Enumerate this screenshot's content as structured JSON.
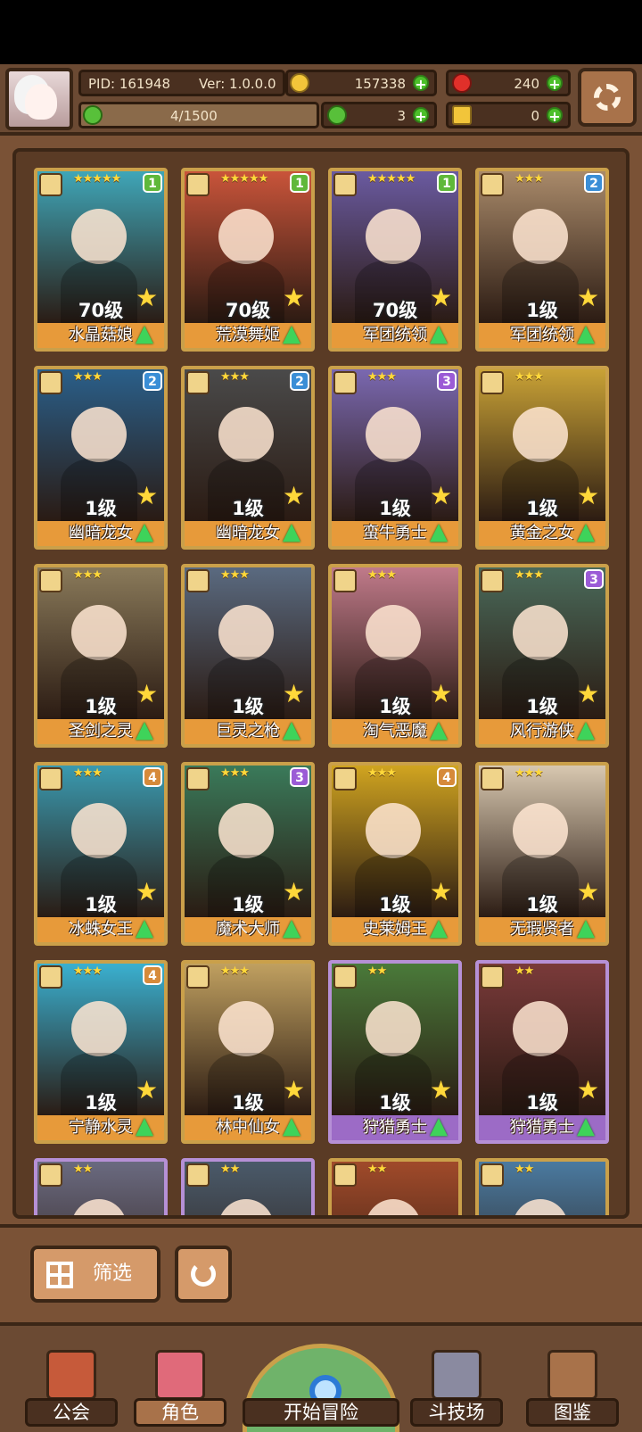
{
  "header": {
    "pid": "PID: 161948",
    "version": "Ver: 1.0.0.0",
    "gold": "157338",
    "gems": "240",
    "capacity": "4/1500",
    "clover": "3",
    "key": "0"
  },
  "cards": [
    {
      "name": "水晶菇娘",
      "level": "70级",
      "stars": "★★★★★",
      "badge": "1",
      "badge_color": "green",
      "rarity": "gold",
      "art_color": "#3fa6b8"
    },
    {
      "name": "荒漠舞姬",
      "level": "70级",
      "stars": "★★★★★",
      "badge": "1",
      "badge_color": "green",
      "rarity": "gold",
      "art_color": "#c9543a"
    },
    {
      "name": "军团统领",
      "level": "70级",
      "stars": "★★★★★",
      "badge": "1",
      "badge_color": "green",
      "rarity": "gold",
      "art_color": "#6a5aa0"
    },
    {
      "name": "军团统领",
      "level": "1级",
      "stars": "★★★",
      "badge": "2",
      "badge_color": "blue",
      "rarity": "gold",
      "art_color": "#a98a6a"
    },
    {
      "name": "幽暗龙女",
      "level": "1级",
      "stars": "★★★",
      "badge": "2",
      "badge_color": "blue",
      "rarity": "gold",
      "art_color": "#2a5f8a"
    },
    {
      "name": "幽暗龙女",
      "level": "1级",
      "stars": "★★★",
      "badge": "2",
      "badge_color": "blue",
      "rarity": "gold",
      "art_color": "#4a4a4a"
    },
    {
      "name": "蛮牛勇士",
      "level": "1级",
      "stars": "★★★",
      "badge": "3",
      "badge_color": "purple",
      "rarity": "gold",
      "art_color": "#7a68b0"
    },
    {
      "name": "黄金之女",
      "level": "1级",
      "stars": "★★★",
      "badge": "",
      "badge_color": "",
      "rarity": "gold",
      "art_color": "#c9a236"
    },
    {
      "name": "圣剑之灵",
      "level": "1级",
      "stars": "★★★",
      "badge": "",
      "badge_color": "",
      "rarity": "gold",
      "art_color": "#8a7a5a"
    },
    {
      "name": "巨灵之枪",
      "level": "1级",
      "stars": "★★★",
      "badge": "",
      "badge_color": "",
      "rarity": "gold",
      "art_color": "#5a6a80"
    },
    {
      "name": "淘气恶魔",
      "level": "1级",
      "stars": "★★★",
      "badge": "",
      "badge_color": "",
      "rarity": "gold",
      "art_color": "#c07a8a"
    },
    {
      "name": "风行游侠",
      "level": "1级",
      "stars": "★★★",
      "badge": "3",
      "badge_color": "purple",
      "rarity": "gold",
      "art_color": "#4a6a5a"
    },
    {
      "name": "冰蛛女王",
      "level": "1级",
      "stars": "★★★",
      "badge": "4",
      "badge_color": "orange",
      "rarity": "gold",
      "art_color": "#3a9ab0"
    },
    {
      "name": "魔术大师",
      "level": "1级",
      "stars": "★★★",
      "badge": "3",
      "badge_color": "purple",
      "rarity": "gold",
      "art_color": "#3a7a5a"
    },
    {
      "name": "史莱姆王",
      "level": "1级",
      "stars": "★★★",
      "badge": "4",
      "badge_color": "orange",
      "rarity": "gold",
      "art_color": "#d0a420"
    },
    {
      "name": "无瑕贤者",
      "level": "1级",
      "stars": "★★★",
      "badge": "",
      "badge_color": "",
      "rarity": "gold",
      "art_color": "#d8c8b0"
    },
    {
      "name": "宁静水灵",
      "level": "1级",
      "stars": "★★★",
      "badge": "4",
      "badge_color": "orange",
      "rarity": "gold",
      "art_color": "#3ab0d0"
    },
    {
      "name": "林中仙女",
      "level": "1级",
      "stars": "★★★",
      "badge": "",
      "badge_color": "",
      "rarity": "gold",
      "art_color": "#c0a060"
    },
    {
      "name": "狩猎勇士",
      "level": "1级",
      "stars": "★★",
      "badge": "",
      "badge_color": "",
      "rarity": "purple",
      "art_color": "#4a7a3a"
    },
    {
      "name": "狩猎勇士",
      "level": "1级",
      "stars": "★★",
      "badge": "",
      "badge_color": "",
      "rarity": "purple",
      "art_color": "#7a3a3a"
    },
    {
      "name": "",
      "level": "",
      "stars": "★★",
      "badge": "",
      "badge_color": "",
      "rarity": "purple",
      "art_color": "#6a6a80"
    },
    {
      "name": "",
      "level": "",
      "stars": "★★",
      "badge": "",
      "badge_color": "",
      "rarity": "purple",
      "art_color": "#4a5a6a"
    },
    {
      "name": "",
      "level": "",
      "stars": "★★",
      "badge": "",
      "badge_color": "",
      "rarity": "gold",
      "art_color": "#a04a2a"
    },
    {
      "name": "",
      "level": "",
      "stars": "★★",
      "badge": "",
      "badge_color": "",
      "rarity": "gold",
      "art_color": "#4a7aa0"
    }
  ],
  "filter": {
    "label": "筛选"
  },
  "nav": [
    {
      "label": "公会",
      "icon": "guild-icon",
      "active": false
    },
    {
      "label": "角色",
      "icon": "character-icon",
      "active": true
    },
    {
      "label": "开始冒险",
      "icon": "adventure-icon",
      "active": false
    },
    {
      "label": "斗技场",
      "icon": "arena-icon",
      "active": false
    },
    {
      "label": "图鉴",
      "icon": "codex-icon",
      "active": false
    }
  ],
  "colors": {
    "frame_brown": "#7a5236",
    "card_gold_border": "#caa04a",
    "card_purple_border": "#b690d6",
    "name_bar_gold": "#e79a3a",
    "name_bar_purple": "#9c6bc6",
    "plus_green": "#4cbf2a"
  }
}
